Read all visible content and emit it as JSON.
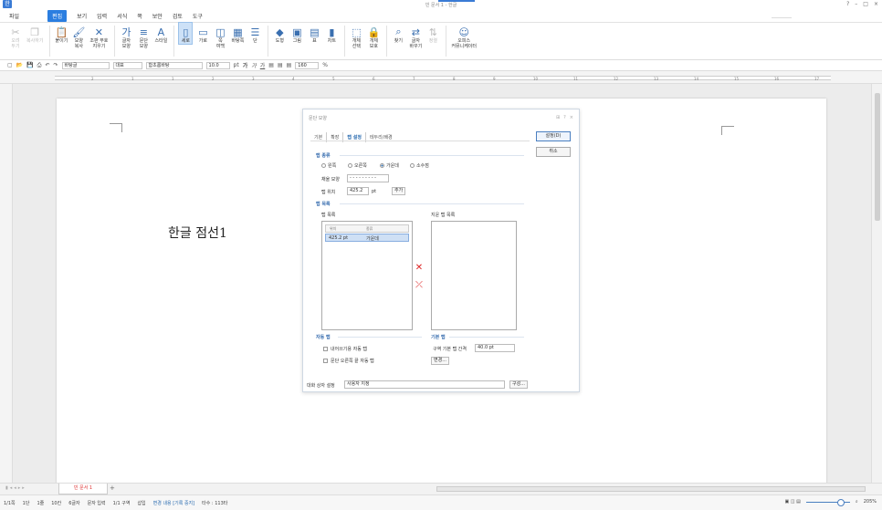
{
  "window": {
    "title": "빈 문서 1 - 한글",
    "logo": "한",
    "right_icons": [
      "?",
      "–",
      "□",
      "×"
    ]
  },
  "menu": {
    "items": [
      "파일",
      "편집",
      "보기",
      "입력",
      "서식",
      "쪽",
      "보안",
      "검토",
      "도구"
    ],
    "active": "편집",
    "arrows": [
      "▾"
    ]
  },
  "ribbon": {
    "buttons": [
      {
        "label": "오려\n두기",
        "icon": "scissors-icon",
        "glyph": "✂",
        "disabled": true
      },
      {
        "label": "복사하기",
        "icon": "copy-icon",
        "glyph": "❐",
        "disabled": true
      },
      {
        "label": "붙이기",
        "icon": "paste-icon",
        "glyph": "📋",
        "disabled": false
      },
      {
        "label": "모양\n복사",
        "icon": "format-painter-icon",
        "glyph": "🖌",
        "disabled": false
      },
      {
        "label": "조판 부호\n지우기",
        "icon": "clear-code-icon",
        "glyph": "✕",
        "disabled": false
      },
      {
        "label": "글자\n모양",
        "icon": "char-shape-icon",
        "glyph": "가",
        "disabled": false
      },
      {
        "label": "문단\n모양",
        "icon": "para-shape-icon",
        "glyph": "≡",
        "disabled": false
      },
      {
        "label": "스타일",
        "icon": "style-icon",
        "glyph": "A",
        "disabled": false
      },
      {
        "label": "세로",
        "icon": "portrait-icon",
        "glyph": "▯",
        "disabled": false,
        "selected": true
      },
      {
        "label": "가로",
        "icon": "landscape-icon",
        "glyph": "▭",
        "disabled": false
      },
      {
        "label": "쪽\n여백",
        "icon": "margin-icon",
        "glyph": "◫",
        "disabled": false
      },
      {
        "label": "바탕쪽",
        "icon": "master-page-icon",
        "glyph": "▦",
        "disabled": false
      },
      {
        "label": "단",
        "icon": "column-icon",
        "glyph": "☰",
        "disabled": false
      },
      {
        "label": "도형",
        "icon": "shape-icon",
        "glyph": "◆",
        "disabled": false
      },
      {
        "label": "그림",
        "icon": "picture-icon",
        "glyph": "▣",
        "disabled": false
      },
      {
        "label": "표",
        "icon": "table-icon",
        "glyph": "▤",
        "disabled": false
      },
      {
        "label": "차트",
        "icon": "chart-icon",
        "glyph": "▮",
        "disabled": false
      },
      {
        "label": "개체\n선택",
        "icon": "select-object-icon",
        "glyph": "⬚",
        "disabled": false
      },
      {
        "label": "개체\n보호",
        "icon": "protect-object-icon",
        "glyph": "🔒",
        "disabled": false
      },
      {
        "label": "찾기",
        "icon": "binoculars-icon",
        "glyph": "⌕",
        "disabled": false
      },
      {
        "label": "글자\n바꾸기",
        "icon": "replace-icon",
        "glyph": "⇄",
        "disabled": false
      },
      {
        "label": "정렬",
        "icon": "sort-icon",
        "glyph": "⇅",
        "disabled": true
      },
      {
        "label": "오피스\n커뮤니케이터",
        "icon": "communicator-icon",
        "glyph": "☺",
        "disabled": false
      }
    ]
  },
  "format_bar": {
    "style": "바탕글",
    "lang": "대표",
    "font": "함초롬바탕",
    "size": "10.0",
    "unit": "pt",
    "bold": "가",
    "italic": "가",
    "underline": "가",
    "zoom": "160",
    "zoom_unit": "%"
  },
  "ruler": {
    "numbers": [
      "2",
      "1",
      "1",
      "2",
      "3",
      "4",
      "5",
      "6",
      "7",
      "8",
      "9",
      "10",
      "11",
      "12",
      "13",
      "14",
      "15",
      "16",
      "17"
    ]
  },
  "document": {
    "body_text": "한글 점선1"
  },
  "dialog": {
    "title": "문단 모양",
    "controls": [
      "⊞",
      "?",
      "×"
    ],
    "tabs": [
      "기본",
      "확장",
      "탭 설정",
      "테두리/배경"
    ],
    "active_tab": "탭 설정",
    "tab_kind": {
      "header": "탭 종류",
      "options": [
        "왼쪽",
        "오른쪽",
        "가운데",
        "소수점"
      ],
      "selected": "가운데",
      "fill_label": "채울 모양",
      "fill_value": "- - - - - - - - -",
      "pos_label": "탭 위치",
      "pos_value": "425.2",
      "pos_unit": "pt",
      "add_button": "추가"
    },
    "tab_list": {
      "header": "탭 목록",
      "list_label": "탭 목록",
      "col_pos": "위치",
      "col_kind": "종류",
      "rows": [
        {
          "pos": "425.2 pt",
          "kind": "가운데"
        }
      ],
      "deleted_label": "지운 탭 목록"
    },
    "auto_tab": {
      "header": "자동 탭",
      "opt1": "내어쓰기용 자동 탭",
      "opt2": "문단 오른쪽 끝 자동 탭"
    },
    "default_tab": {
      "header": "기본 탭",
      "label": "구역 기본 탭 간격",
      "value": "40.0 pt",
      "change_button": "변경..."
    },
    "footer": {
      "label": "대화 상자 설정",
      "value": "사용자 지정",
      "button": "구성..."
    },
    "side_buttons": {
      "ok": "설정(D)",
      "cancel": "취소"
    }
  },
  "tabbar": {
    "doc_tab": "빈 문서 1",
    "plus": "+"
  },
  "status": {
    "items": [
      "1/1쪽",
      "1단",
      "1줄",
      "10칸",
      "6글자",
      "문자 입력",
      "1/1 구역",
      "삽입",
      "변경 내용 [기록 중지]",
      "타수 : 113타"
    ],
    "zoom": "205%"
  }
}
